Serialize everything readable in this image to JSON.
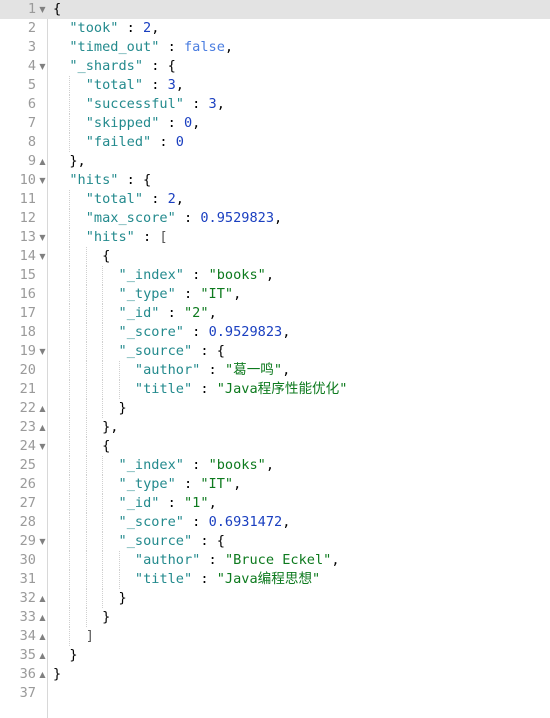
{
  "editor": {
    "active_line": 1,
    "colors": {
      "key": "#238a8d",
      "number": "#1a3fc0",
      "boolean": "#4a7de0",
      "string": "#0d7a1e",
      "active_line_bg": "#e3e3e3"
    },
    "lines": [
      {
        "n": "1",
        "fold": "down",
        "indent": 0,
        "tokens": [
          {
            "t": "p",
            "v": "{"
          }
        ]
      },
      {
        "n": "2",
        "fold": "",
        "indent": 1,
        "tokens": [
          {
            "t": "k",
            "v": "\"took\""
          },
          {
            "t": "p",
            "v": " : "
          },
          {
            "t": "n",
            "v": "2"
          },
          {
            "t": "p",
            "v": ","
          }
        ]
      },
      {
        "n": "3",
        "fold": "",
        "indent": 1,
        "tokens": [
          {
            "t": "k",
            "v": "\"timed_out\""
          },
          {
            "t": "p",
            "v": " : "
          },
          {
            "t": "b",
            "v": "false"
          },
          {
            "t": "p",
            "v": ","
          }
        ]
      },
      {
        "n": "4",
        "fold": "down",
        "indent": 1,
        "tokens": [
          {
            "t": "k",
            "v": "\"_shards\""
          },
          {
            "t": "p",
            "v": " : {"
          }
        ]
      },
      {
        "n": "5",
        "fold": "",
        "indent": 2,
        "tokens": [
          {
            "t": "k",
            "v": "\"total\""
          },
          {
            "t": "p",
            "v": " : "
          },
          {
            "t": "n",
            "v": "3"
          },
          {
            "t": "p",
            "v": ","
          }
        ]
      },
      {
        "n": "6",
        "fold": "",
        "indent": 2,
        "tokens": [
          {
            "t": "k",
            "v": "\"successful\""
          },
          {
            "t": "p",
            "v": " : "
          },
          {
            "t": "n",
            "v": "3"
          },
          {
            "t": "p",
            "v": ","
          }
        ]
      },
      {
        "n": "7",
        "fold": "",
        "indent": 2,
        "tokens": [
          {
            "t": "k",
            "v": "\"skipped\""
          },
          {
            "t": "p",
            "v": " : "
          },
          {
            "t": "n",
            "v": "0"
          },
          {
            "t": "p",
            "v": ","
          }
        ]
      },
      {
        "n": "8",
        "fold": "",
        "indent": 2,
        "tokens": [
          {
            "t": "k",
            "v": "\"failed\""
          },
          {
            "t": "p",
            "v": " : "
          },
          {
            "t": "n",
            "v": "0"
          }
        ]
      },
      {
        "n": "9",
        "fold": "up",
        "indent": 1,
        "tokens": [
          {
            "t": "p",
            "v": "},"
          }
        ]
      },
      {
        "n": "10",
        "fold": "down",
        "indent": 1,
        "tokens": [
          {
            "t": "k",
            "v": "\"hits\""
          },
          {
            "t": "p",
            "v": " : {"
          }
        ]
      },
      {
        "n": "11",
        "fold": "",
        "indent": 2,
        "tokens": [
          {
            "t": "k",
            "v": "\"total\""
          },
          {
            "t": "p",
            "v": " : "
          },
          {
            "t": "n",
            "v": "2"
          },
          {
            "t": "p",
            "v": ","
          }
        ]
      },
      {
        "n": "12",
        "fold": "",
        "indent": 2,
        "tokens": [
          {
            "t": "k",
            "v": "\"max_score\""
          },
          {
            "t": "p",
            "v": " : "
          },
          {
            "t": "n",
            "v": "0.9529823"
          },
          {
            "t": "p",
            "v": ","
          }
        ]
      },
      {
        "n": "13",
        "fold": "down",
        "indent": 2,
        "tokens": [
          {
            "t": "k",
            "v": "\"hits\""
          },
          {
            "t": "p",
            "v": " : "
          },
          {
            "t": "br",
            "v": "["
          }
        ]
      },
      {
        "n": "14",
        "fold": "down",
        "indent": 3,
        "tokens": [
          {
            "t": "p",
            "v": "{"
          }
        ]
      },
      {
        "n": "15",
        "fold": "",
        "indent": 4,
        "tokens": [
          {
            "t": "k",
            "v": "\"_index\""
          },
          {
            "t": "p",
            "v": " : "
          },
          {
            "t": "s",
            "v": "\"books\""
          },
          {
            "t": "p",
            "v": ","
          }
        ]
      },
      {
        "n": "16",
        "fold": "",
        "indent": 4,
        "tokens": [
          {
            "t": "k",
            "v": "\"_type\""
          },
          {
            "t": "p",
            "v": " : "
          },
          {
            "t": "s",
            "v": "\"IT\""
          },
          {
            "t": "p",
            "v": ","
          }
        ]
      },
      {
        "n": "17",
        "fold": "",
        "indent": 4,
        "tokens": [
          {
            "t": "k",
            "v": "\"_id\""
          },
          {
            "t": "p",
            "v": " : "
          },
          {
            "t": "s",
            "v": "\"2\""
          },
          {
            "t": "p",
            "v": ","
          }
        ]
      },
      {
        "n": "18",
        "fold": "",
        "indent": 4,
        "tokens": [
          {
            "t": "k",
            "v": "\"_score\""
          },
          {
            "t": "p",
            "v": " : "
          },
          {
            "t": "n",
            "v": "0.9529823"
          },
          {
            "t": "p",
            "v": ","
          }
        ]
      },
      {
        "n": "19",
        "fold": "down",
        "indent": 4,
        "tokens": [
          {
            "t": "k",
            "v": "\"_source\""
          },
          {
            "t": "p",
            "v": " : {"
          }
        ]
      },
      {
        "n": "20",
        "fold": "",
        "indent": 5,
        "tokens": [
          {
            "t": "k",
            "v": "\"author\""
          },
          {
            "t": "p",
            "v": " : "
          },
          {
            "t": "s",
            "v": "\"葛一鸣\""
          },
          {
            "t": "p",
            "v": ","
          }
        ]
      },
      {
        "n": "21",
        "fold": "",
        "indent": 5,
        "tokens": [
          {
            "t": "k",
            "v": "\"title\""
          },
          {
            "t": "p",
            "v": " : "
          },
          {
            "t": "s",
            "v": "\"Java程序性能优化\""
          }
        ]
      },
      {
        "n": "22",
        "fold": "up",
        "indent": 4,
        "tokens": [
          {
            "t": "p",
            "v": "}"
          }
        ]
      },
      {
        "n": "23",
        "fold": "up",
        "indent": 3,
        "tokens": [
          {
            "t": "p",
            "v": "},"
          }
        ]
      },
      {
        "n": "24",
        "fold": "down",
        "indent": 3,
        "tokens": [
          {
            "t": "p",
            "v": "{"
          }
        ]
      },
      {
        "n": "25",
        "fold": "",
        "indent": 4,
        "tokens": [
          {
            "t": "k",
            "v": "\"_index\""
          },
          {
            "t": "p",
            "v": " : "
          },
          {
            "t": "s",
            "v": "\"books\""
          },
          {
            "t": "p",
            "v": ","
          }
        ]
      },
      {
        "n": "26",
        "fold": "",
        "indent": 4,
        "tokens": [
          {
            "t": "k",
            "v": "\"_type\""
          },
          {
            "t": "p",
            "v": " : "
          },
          {
            "t": "s",
            "v": "\"IT\""
          },
          {
            "t": "p",
            "v": ","
          }
        ]
      },
      {
        "n": "27",
        "fold": "",
        "indent": 4,
        "tokens": [
          {
            "t": "k",
            "v": "\"_id\""
          },
          {
            "t": "p",
            "v": " : "
          },
          {
            "t": "s",
            "v": "\"1\""
          },
          {
            "t": "p",
            "v": ","
          }
        ]
      },
      {
        "n": "28",
        "fold": "",
        "indent": 4,
        "tokens": [
          {
            "t": "k",
            "v": "\"_score\""
          },
          {
            "t": "p",
            "v": " : "
          },
          {
            "t": "n",
            "v": "0.6931472"
          },
          {
            "t": "p",
            "v": ","
          }
        ]
      },
      {
        "n": "29",
        "fold": "down",
        "indent": 4,
        "tokens": [
          {
            "t": "k",
            "v": "\"_source\""
          },
          {
            "t": "p",
            "v": " : {"
          }
        ]
      },
      {
        "n": "30",
        "fold": "",
        "indent": 5,
        "tokens": [
          {
            "t": "k",
            "v": "\"author\""
          },
          {
            "t": "p",
            "v": " : "
          },
          {
            "t": "s",
            "v": "\"Bruce Eckel\""
          },
          {
            "t": "p",
            "v": ","
          }
        ]
      },
      {
        "n": "31",
        "fold": "",
        "indent": 5,
        "tokens": [
          {
            "t": "k",
            "v": "\"title\""
          },
          {
            "t": "p",
            "v": " : "
          },
          {
            "t": "s",
            "v": "\"Java编程思想\""
          }
        ]
      },
      {
        "n": "32",
        "fold": "up",
        "indent": 4,
        "tokens": [
          {
            "t": "p",
            "v": "}"
          }
        ]
      },
      {
        "n": "33",
        "fold": "up",
        "indent": 3,
        "tokens": [
          {
            "t": "p",
            "v": "}"
          }
        ]
      },
      {
        "n": "34",
        "fold": "up",
        "indent": 2,
        "tokens": [
          {
            "t": "br",
            "v": "]"
          }
        ]
      },
      {
        "n": "35",
        "fold": "up",
        "indent": 1,
        "tokens": [
          {
            "t": "p",
            "v": "}"
          }
        ]
      },
      {
        "n": "36",
        "fold": "up",
        "indent": 0,
        "tokens": [
          {
            "t": "p",
            "v": "}"
          }
        ]
      },
      {
        "n": "37",
        "fold": "",
        "indent": 0,
        "tokens": []
      }
    ]
  }
}
